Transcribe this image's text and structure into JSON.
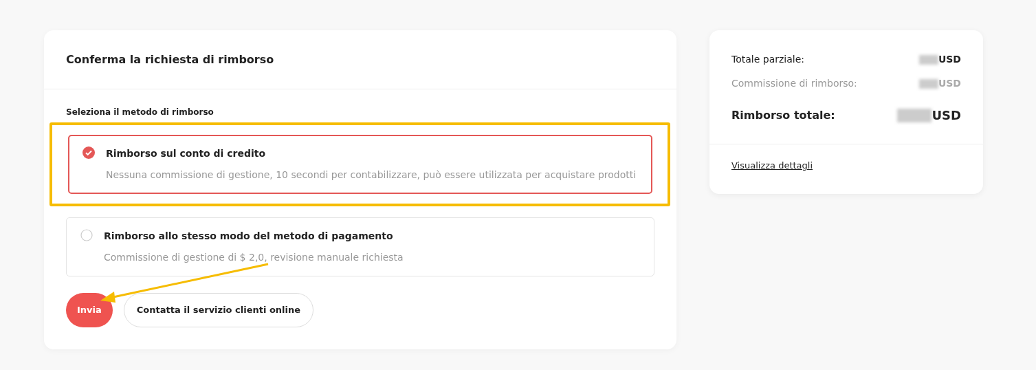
{
  "refund_form": {
    "title": "Conferma la richiesta di rimborso",
    "section_label": "Seleziona il metodo di rimborso",
    "options": [
      {
        "title": "Rimborso sul conto di credito",
        "description": "Nessuna commissione di gestione, 10 secondi per contabilizzare, può essere utilizzata per acquistare prodotti",
        "selected": true,
        "highlighted": true
      },
      {
        "title": "Rimborso allo stesso modo del metodo di pagamento",
        "description": "Commissione di gestione di $ 2,0, revisione manuale richiesta",
        "selected": false,
        "highlighted": false
      }
    ],
    "buttons": [
      {
        "label": "Invia",
        "kind": "primary"
      },
      {
        "label": "Contatta il servizio clienti online",
        "kind": "outline"
      }
    ]
  },
  "summary": {
    "rows": [
      {
        "label": "Totale parziale:",
        "currency": "USD",
        "kind": "normal"
      },
      {
        "label": "Commissione di rimborso:",
        "currency": "USD",
        "kind": "muted"
      },
      {
        "label": "Rimborso totale:",
        "currency": "USD",
        "kind": "total"
      }
    ],
    "link": "Visualizza dettagli"
  }
}
